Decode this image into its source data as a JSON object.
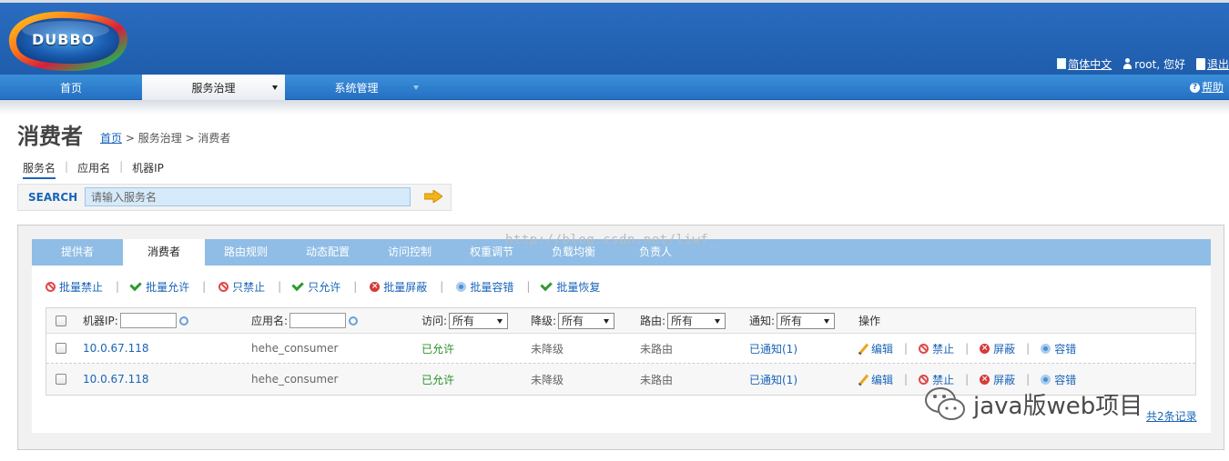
{
  "header": {
    "logo_text": "DUBBO",
    "lang_link": "简体中文",
    "user_text": "root, 您好",
    "logout_link": "退出"
  },
  "nav": {
    "items": [
      "首页",
      "服务治理",
      "系统管理"
    ],
    "help": "帮助"
  },
  "page": {
    "title": "消费者",
    "breadcrumb_home": "首页",
    "breadcrumb_rest": "> 服务治理 > 消费者"
  },
  "search": {
    "tabs": [
      "服务名",
      "应用名",
      "机器IP"
    ],
    "label": "SEARCH",
    "placeholder": "请输入服务名"
  },
  "tabs": [
    "提供者",
    "消费者",
    "路由规则",
    "动态配置",
    "访问控制",
    "权重调节",
    "负载均衡",
    "负责人"
  ],
  "watermark": "http://blog.csdn.net/liwf_",
  "actions": [
    "批量禁止",
    "批量允许",
    "只禁止",
    "只允许",
    "批量屏蔽",
    "批量容错",
    "批量恢复"
  ],
  "table": {
    "headers": {
      "ip": "机器IP:",
      "app": "应用名:",
      "access": "访问:",
      "degrade": "降级:",
      "route": "路由:",
      "notify": "通知:",
      "ops": "操作",
      "select_all": "所有"
    },
    "rows": [
      {
        "ip": "10.0.67.118",
        "app": "hehe_consumer",
        "access": "已允许",
        "degrade": "未降级",
        "route": "未路由",
        "notify": "已通知(1)",
        "ops": [
          "编辑",
          "禁止",
          "屏蔽",
          "容错"
        ]
      },
      {
        "ip": "10.0.67.118",
        "app": "hehe_consumer",
        "access": "已允许",
        "degrade": "未降级",
        "route": "未路由",
        "notify": "已通知(1)",
        "ops": [
          "编辑",
          "禁止",
          "屏蔽",
          "容错"
        ]
      }
    ],
    "total": "共2条记录"
  },
  "overlay_watermark": "java版web项目"
}
